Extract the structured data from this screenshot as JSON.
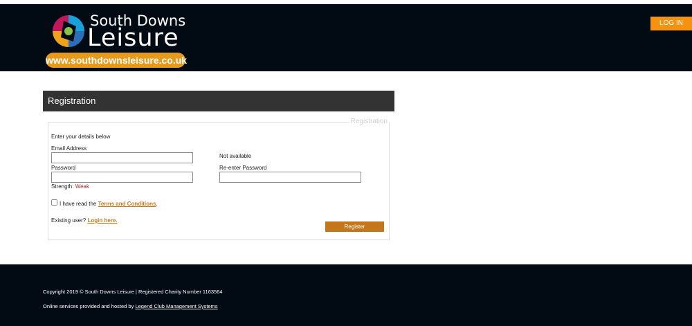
{
  "header": {
    "logo": {
      "line1": "South Downs",
      "line2": "Leisure",
      "url": "www.southdownsleisure.co.uk"
    },
    "login_label": "LOG IN"
  },
  "panel": {
    "title": "Registration",
    "legend": "Registration"
  },
  "form": {
    "intro": "Enter your details below",
    "email_label": "Email Address",
    "email_value": "",
    "email_status": "Not available",
    "password_label": "Password",
    "password_value": "",
    "reenter_label": "Re-enter Password",
    "reenter_value": "",
    "strength_label": "Strength:",
    "strength_value": "Weak",
    "terms_prefix": "I have read the",
    "terms_link": "Terms and Conditions",
    "terms_suffix": ".",
    "terms_checked": false,
    "existing_prefix": "Existing user?",
    "existing_link": "Login here.",
    "register_label": "Register"
  },
  "footer": {
    "copyright": "Copyright 2019 © South Downs Leisure | Registered Charity Number 1163564",
    "hosted_prefix": "Online services provided and hosted by",
    "hosted_link": "Legend Club Management Systems"
  },
  "colors": {
    "header_bg": "#020a14",
    "accent_orange": "#f5920f",
    "register_orange": "#c4761b",
    "link_orange": "#c47a1a",
    "weak_red": "#a52a2a",
    "panel_title_bg": "#333333"
  }
}
